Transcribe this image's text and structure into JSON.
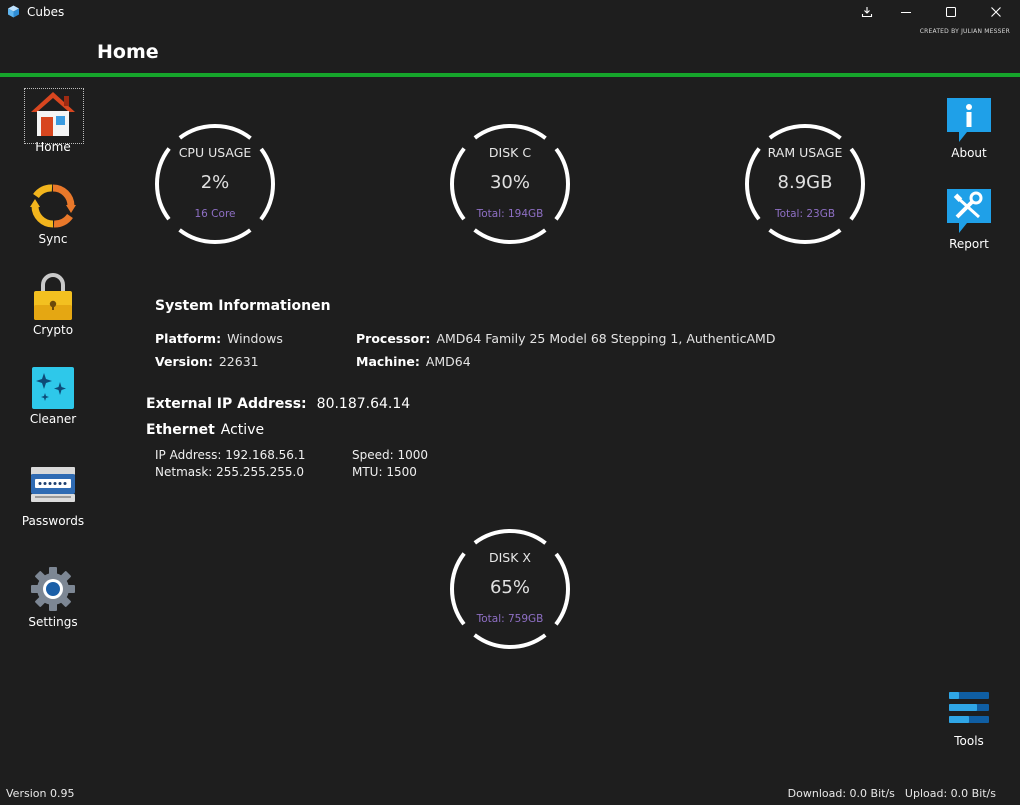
{
  "window": {
    "title": "Cubes",
    "controls": [
      "download-icon",
      "minimize-icon",
      "maximize-icon",
      "close-icon"
    ]
  },
  "header": {
    "page_title": "Home",
    "credit": "CREATED BY JULIAN MESSER",
    "accent_color": "#16a52b"
  },
  "sidebar_left": {
    "items": [
      {
        "label": "Home",
        "icon": "home-icon",
        "selected": true
      },
      {
        "label": "Sync",
        "icon": "sync-icon"
      },
      {
        "label": "Crypto",
        "icon": "lock-icon"
      },
      {
        "label": "Cleaner",
        "icon": "sparkle-icon"
      },
      {
        "label": "Passwords",
        "icon": "password-keyboard-icon"
      },
      {
        "label": "Settings",
        "icon": "gear-icon"
      }
    ]
  },
  "sidebar_right": {
    "items": [
      {
        "label": "About",
        "icon": "info-icon"
      },
      {
        "label": "Report",
        "icon": "tools-report-icon"
      },
      {
        "label": "Tools",
        "icon": "bars-icon"
      }
    ]
  },
  "gauges": [
    {
      "title": "CPU USAGE",
      "value": "2%",
      "sub": "16 Core"
    },
    {
      "title": "DISK C",
      "value": "30%",
      "sub": "Total: 194GB"
    },
    {
      "title": "RAM USAGE",
      "value": "8.9GB",
      "sub": "Total: 23GB"
    },
    {
      "title": "DISK X",
      "value": "65%",
      "sub": "Total: 759GB"
    }
  ],
  "system_info": {
    "heading": "System Informationen",
    "platform_label": "Platform:",
    "platform": "Windows",
    "version_label": "Version:",
    "version": "22631",
    "processor_label": "Processor:",
    "processor": "AMD64 Family 25 Model 68 Stepping 1, AuthenticAMD",
    "machine_label": "Machine:",
    "machine": "AMD64"
  },
  "network": {
    "external_label": "External IP Address:",
    "external_ip": "80.187.64.14",
    "ethernet_label": "Ethernet",
    "ethernet_status": "Active",
    "ip_address": "IP Address: 192.168.56.1",
    "netmask": "Netmask: 255.255.255.0",
    "speed": "Speed: 1000",
    "mtu": "MTU: 1500"
  },
  "footer": {
    "version": "Version 0.95",
    "download": "Download: 0.0 Bit/s",
    "upload": "Upload: 0.0 Bit/s"
  }
}
